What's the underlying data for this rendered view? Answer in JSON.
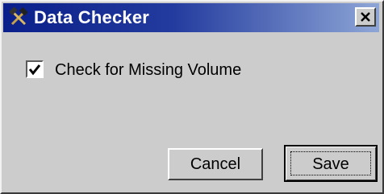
{
  "window": {
    "title": "Data Checker",
    "title_icon": "hammer-tools-icon",
    "close_icon": "close-icon",
    "titlebar_color_left": "#0a1f8a",
    "titlebar_color_right": "#8ea6d6",
    "face_color": "#cccccc"
  },
  "options": {
    "missing_volume": {
      "label": "Check for Missing Volume",
      "checked": true
    }
  },
  "buttons": {
    "cancel_label": "Cancel",
    "save_label": "Save"
  }
}
